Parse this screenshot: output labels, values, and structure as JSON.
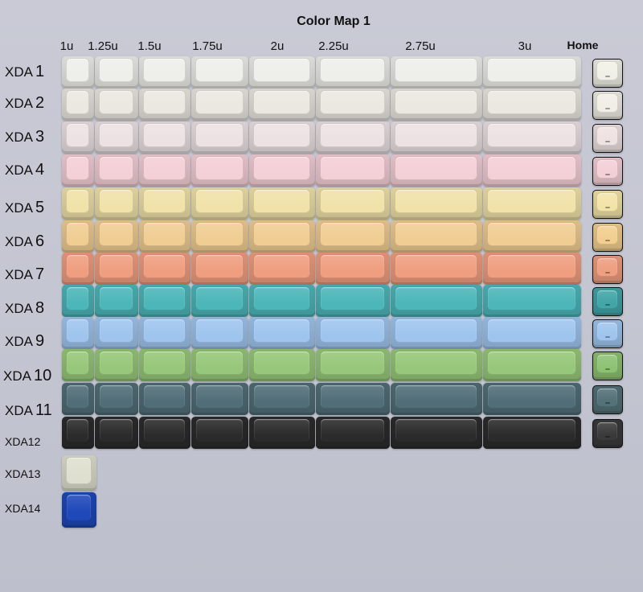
{
  "title": "Color Map 1",
  "columns": [
    "1u",
    "1.25u",
    "1.5u",
    "1.75u",
    "2u",
    "2.25u",
    "2.75u",
    "3u",
    "Home"
  ],
  "rows": [
    {
      "label": "XDA",
      "num": "1",
      "color": "#eeeeea"
    },
    {
      "label": "XDA",
      "num": "2",
      "color": "#ebe8e1"
    },
    {
      "label": "XDA",
      "num": "3",
      "color": "#ece2e4"
    },
    {
      "label": "XDA",
      "num": "4",
      "color": "#f3cfd6"
    },
    {
      "label": "XDA",
      "num": "5",
      "color": "#f0e2a9"
    },
    {
      "label": "XDA",
      "num": "6",
      "color": "#f0cd93"
    },
    {
      "label": "XDA",
      "num": "7",
      "color": "#ef9e80"
    },
    {
      "label": "XDA",
      "num": "8",
      "color": "#4db6b9"
    },
    {
      "label": "XDA",
      "num": "9",
      "color": "#9fc5ee"
    },
    {
      "label": "XDA",
      "num": "10",
      "color": "#97c77a"
    },
    {
      "label": "XDA",
      "num": "11",
      "color": "#516e78"
    },
    {
      "label": "XDA12",
      "num": "",
      "color": "#2b2b2b"
    },
    {
      "label": "XDA13",
      "num": "",
      "color": "#dfdfcf"
    },
    {
      "label": "XDA14",
      "num": "",
      "color": "#1f48b8"
    }
  ],
  "home_colors": [
    "#f1f0e6",
    "#f1eee6",
    "#efe2e2",
    "#f3cfd6",
    "#f2e4a8",
    "#f2cf90",
    "#ef9e80",
    "#42a5a8",
    "#9fc5ee",
    "#8dc273",
    "#537178",
    "#3a3a3a"
  ]
}
